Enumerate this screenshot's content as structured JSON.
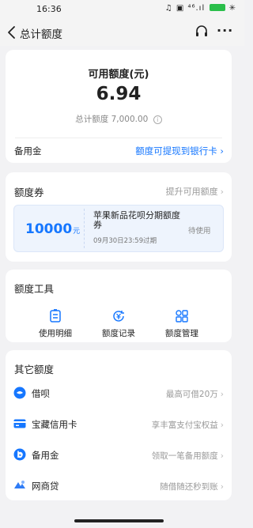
{
  "status_bar": {
    "time": "16:36",
    "icons_text": "♫ ▣ ⁴⁶.ıl",
    "charge_icon": "✳"
  },
  "nav": {
    "title": "总计额度",
    "more": "···"
  },
  "summary": {
    "available_label": "可用额度(元)",
    "available_value": "6.94",
    "total_label": "总计额度",
    "total_value": "7,000.00",
    "info_glyph": "i",
    "reserve_label": "备用金",
    "withdraw_link": "额度可提现到银行卡"
  },
  "coupon_section": {
    "title": "额度券",
    "side_link": "提升可用额度",
    "coupon": {
      "amount": "10000",
      "unit": "元",
      "title": "苹果新品花呗分期额度券",
      "expire": "09月30日23:59过期",
      "status": "待使用"
    }
  },
  "tools_section": {
    "title": "额度工具",
    "items": [
      {
        "label": "使用明细",
        "icon": "document-list-icon"
      },
      {
        "label": "额度记录",
        "icon": "yen-record-icon"
      },
      {
        "label": "额度管理",
        "icon": "grid-manage-icon"
      }
    ]
  },
  "other_section": {
    "title": "其它额度",
    "rows": [
      {
        "label": "借呗",
        "sub": "最高可借20万",
        "icon": "jiebei-icon",
        "color": "#1677ff"
      },
      {
        "label": "宝藏信用卡",
        "sub": "享丰富支付宝权益",
        "icon": "credit-card-icon",
        "color": "#1677ff"
      },
      {
        "label": "备用金",
        "sub": "领取一笔备用额度",
        "icon": "reserve-fund-icon",
        "color": "#1677ff"
      },
      {
        "label": "网商贷",
        "sub": "随借随还秒到账",
        "icon": "mybank-loan-icon",
        "color": "#2f7cf6"
      }
    ]
  },
  "colors": {
    "accent": "#1677ff",
    "background": "#f2f2f4",
    "card": "#ffffff",
    "muted": "#999999"
  }
}
